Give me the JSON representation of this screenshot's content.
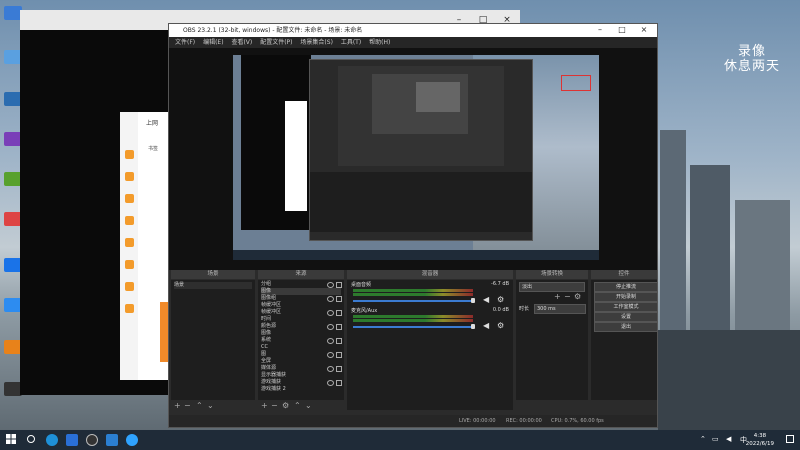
{
  "wallpaper": {
    "line1": "录像",
    "line2": "休息两天"
  },
  "obs": {
    "title": "OBS 23.2.1 (32-bit, windows) - 配置文件: 未命名 - 场景: 未命名",
    "menu": [
      "文件(F)",
      "编辑(E)",
      "查看(V)",
      "配置文件(P)",
      "场景集合(S)",
      "工具(T)",
      "帮助(H)"
    ],
    "docks": {
      "scenes": "场景",
      "sources": "来源",
      "mixer": "混音器",
      "transitions": "场景转换",
      "controls": "控件"
    },
    "scene_item": "场景",
    "sources": [
      "分组",
      "图像",
      "图像组",
      "帧缓冲区",
      "帧缓冲区",
      "时间",
      "颜色源",
      "图像",
      "系统",
      "CC",
      "图",
      "全屏",
      "媒体源",
      "显示器捕获",
      "游戏捕获",
      "游戏捕获 2"
    ],
    "mixer": [
      {
        "name": "桌面音频",
        "db": "-6.7 dB"
      },
      {
        "name": "麦克风/Aux",
        "db": "0.0 dB"
      }
    ],
    "transition": {
      "type": "淡出",
      "duration_label": "时长",
      "duration_value": "300 ms"
    },
    "controls": [
      "停止推流",
      "开始录制",
      "工作室模式",
      "设置",
      "退出"
    ],
    "status": {
      "live": "LIVE: 00:00:00",
      "rec": "REC: 00:00:00",
      "cpu": "CPU: 0.7%, 60.00 fps"
    }
  },
  "browser": {
    "tab_text": "上网",
    "left_label": "书签"
  },
  "taskbar": {
    "time": "4:38",
    "date": "2022/6/19",
    "ime": "中"
  },
  "colors": {
    "obs_bg": "#2b2b2b",
    "taskbar": "#1f2b38",
    "accent": "#3b7bd1"
  }
}
